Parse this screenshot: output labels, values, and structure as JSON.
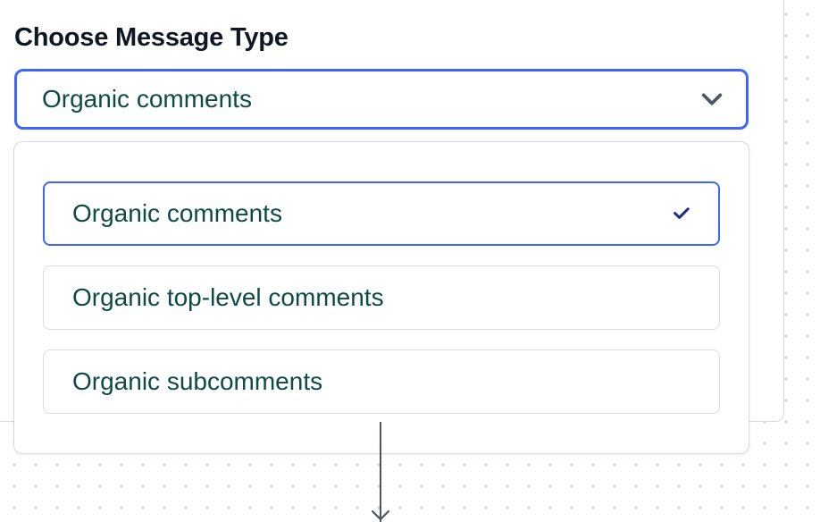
{
  "field": {
    "label": "Choose Message Type",
    "selected_value": "Organic comments"
  },
  "options": [
    {
      "label": "Organic comments",
      "selected": true
    },
    {
      "label": "Organic top-level comments",
      "selected": false
    },
    {
      "label": "Organic subcomments",
      "selected": false
    }
  ]
}
